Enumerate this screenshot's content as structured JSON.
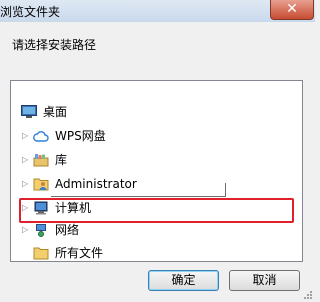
{
  "window": {
    "title": "浏览文件夹",
    "close_glyph": "✕"
  },
  "prompt": "请选择安装路径",
  "tree": {
    "items": [
      {
        "label": "桌面",
        "icon": "desktop-icon",
        "expander": ""
      },
      {
        "label": "WPS网盘",
        "icon": "cloud-icon",
        "expander": "▷"
      },
      {
        "label": "库",
        "icon": "library-icon",
        "expander": "▷"
      },
      {
        "label": "Administrator",
        "icon": "user-folder-icon",
        "expander": "▷"
      },
      {
        "label": "计算机",
        "icon": "computer-icon",
        "expander": "▷"
      },
      {
        "label": "网络",
        "icon": "network-icon",
        "expander": "▷"
      },
      {
        "label": "所有文件",
        "icon": "folder-icon",
        "expander": ""
      }
    ],
    "highlighted": "计算机"
  },
  "buttons": {
    "ok": "确定",
    "cancel": "取消"
  },
  "colors": {
    "highlight_border": "#e0212b",
    "title_bar": "#c9d9ec",
    "close_button": "#c74b32"
  }
}
